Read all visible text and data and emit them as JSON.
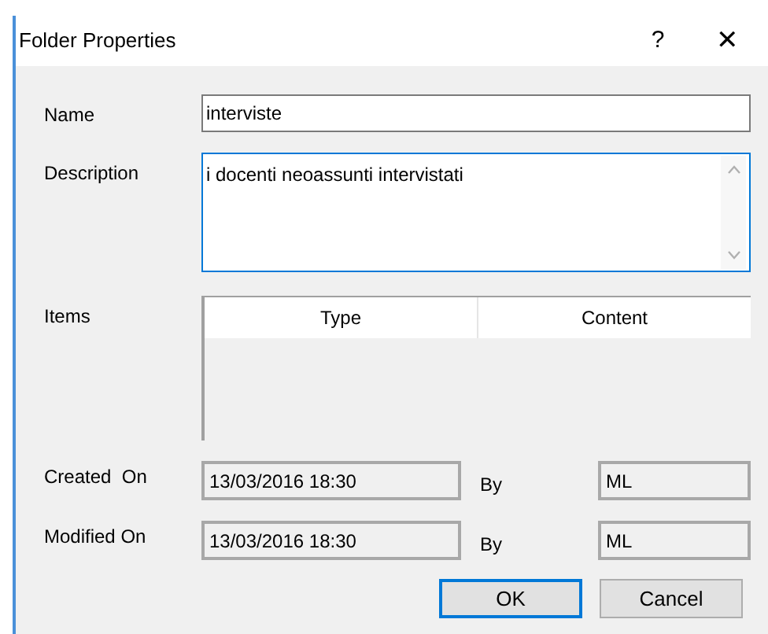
{
  "window": {
    "title": "Folder Properties",
    "help": "?",
    "close": "✕"
  },
  "fields": [
    {
      "label": "Name",
      "value": "interviste",
      "focused": false
    },
    {
      "label": "Description",
      "value": "i docenti neoassunti intervistati",
      "focused": true
    }
  ],
  "items": {
    "label": "Items",
    "columns": [
      "Type",
      "Content"
    ]
  },
  "audit": [
    {
      "label": "Created  On",
      "date": "13/03/2016 18:30",
      "by_label": "By",
      "by": "ML",
      "readonly": true
    },
    {
      "label": "Modified On",
      "date": "13/03/2016 18:30",
      "by_label": "By",
      "by": "ML",
      "readonly": true
    }
  ],
  "buttons": [
    {
      "label": "OK",
      "default": true
    },
    {
      "label": "Cancel",
      "default": false
    }
  ]
}
